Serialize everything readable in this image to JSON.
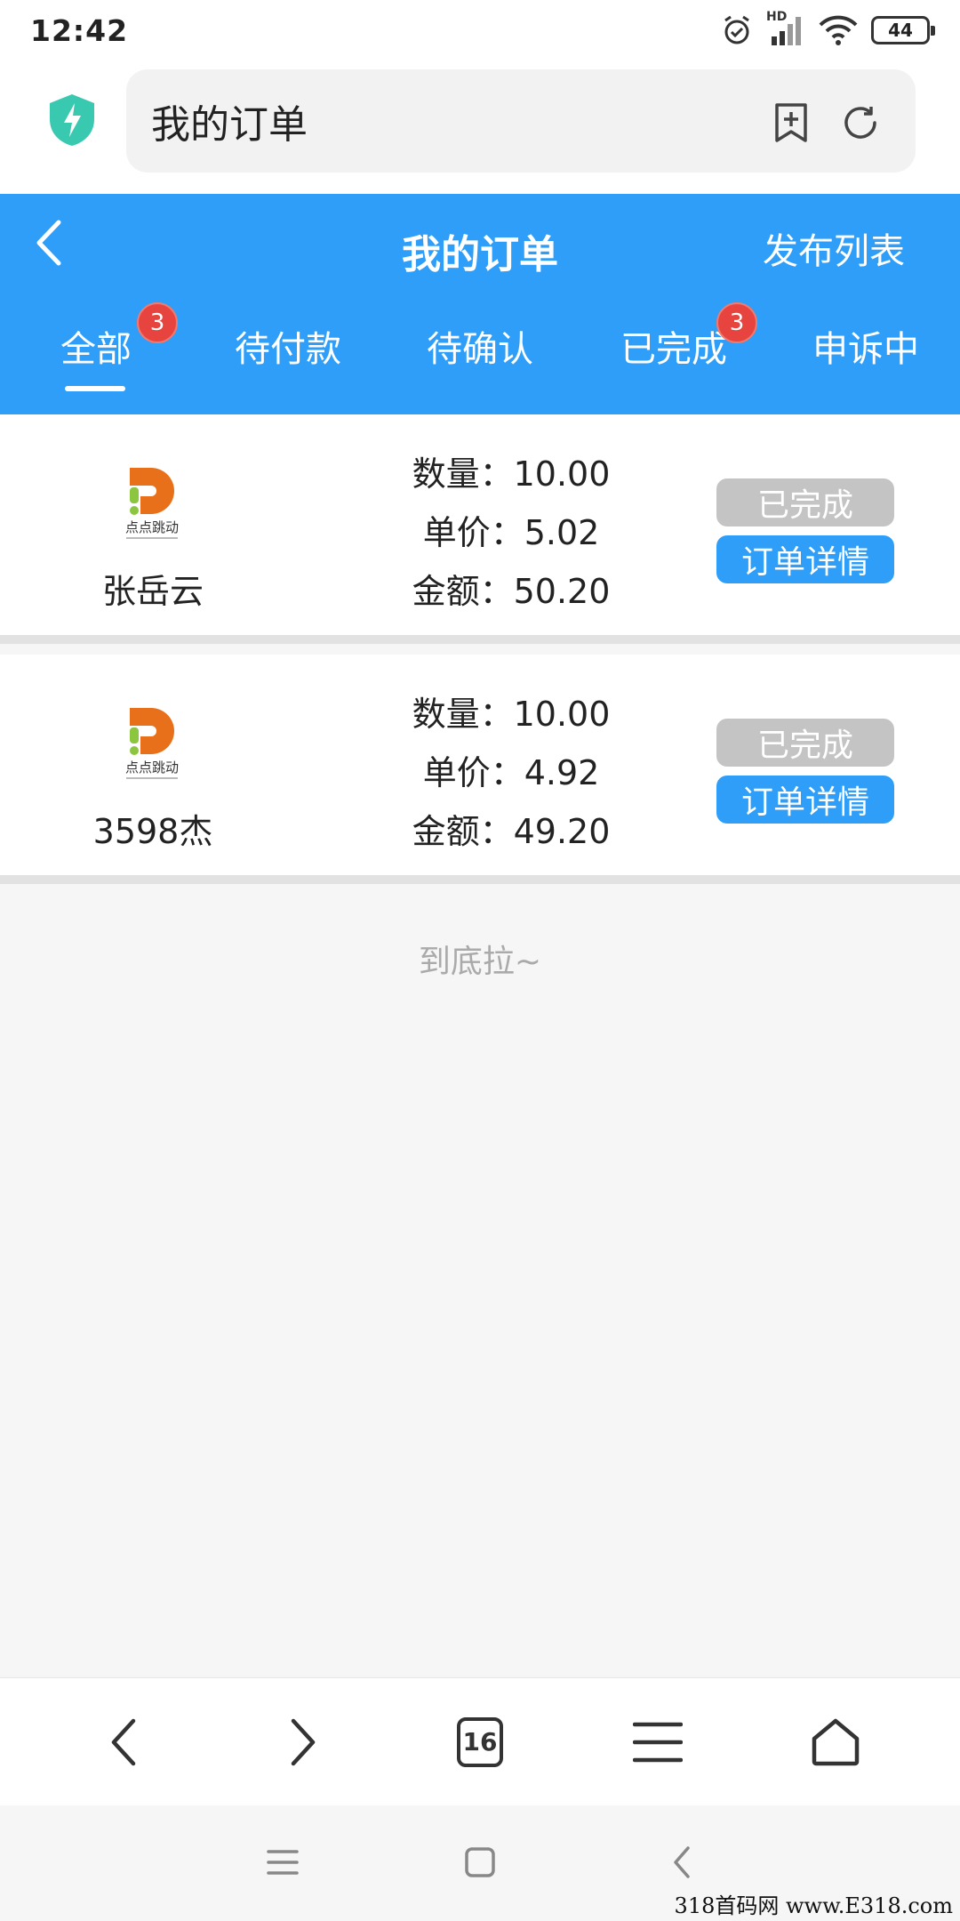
{
  "status_bar": {
    "time": "12:42",
    "battery": "44",
    "network": "HD"
  },
  "address_bar": {
    "url_text": "我的订单"
  },
  "header": {
    "title": "我的订单",
    "right_link": "发布列表",
    "tabs": [
      {
        "label": "全部",
        "badge": "3",
        "active": true
      },
      {
        "label": "待付款"
      },
      {
        "label": "待确认"
      },
      {
        "label": "已完成",
        "badge": "3"
      },
      {
        "label": "申诉中"
      }
    ]
  },
  "orders": [
    {
      "user": "张岳云",
      "logo_text": "点点跳动",
      "quantity": "数量：10.00",
      "unit_price": "单价：5.02",
      "amount": "金额：50.20",
      "status": "已完成",
      "detail_label": "订单详情"
    },
    {
      "user": "3598杰",
      "logo_text": "点点跳动",
      "quantity": "数量：10.00",
      "unit_price": "单价：4.92",
      "amount": "金额：49.20",
      "status": "已完成",
      "detail_label": "订单详情"
    }
  ],
  "end_text": "到底拉~",
  "browser_nav": {
    "tab_count": "16"
  },
  "watermark": "318首码网 www.E318.com",
  "colors": {
    "accent": "#2e9ef8",
    "badge": "#e8443f",
    "done_button": "#c4c4c4"
  }
}
